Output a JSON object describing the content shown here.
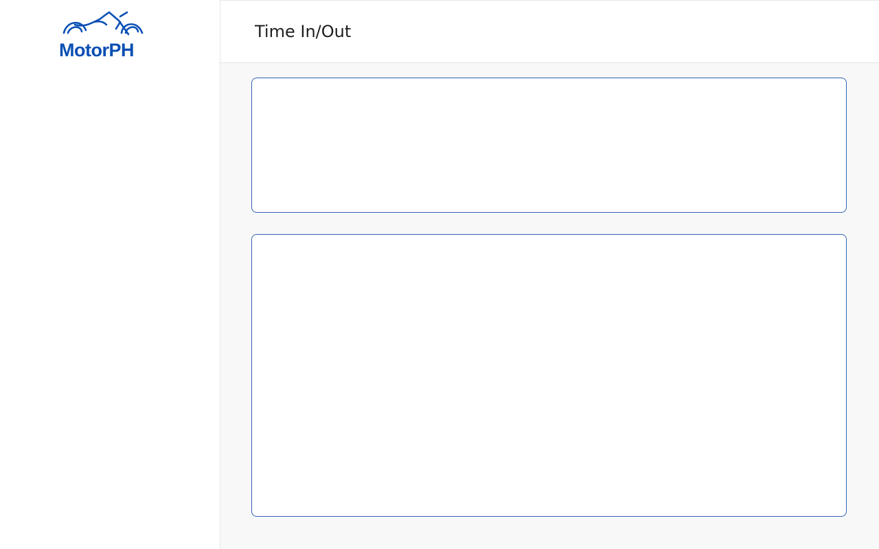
{
  "brand": {
    "name": "MotorPH",
    "logo_icon": "motorcycle-icon",
    "color": "#0a4fb4"
  },
  "header": {
    "title": "Time In/Out"
  },
  "colors": {
    "card_border": "#2f63b0",
    "main_background": "#f8f8f8"
  }
}
